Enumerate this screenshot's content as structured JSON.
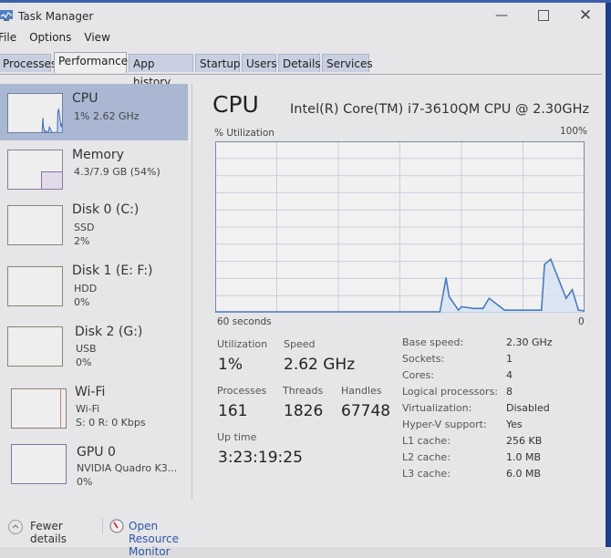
{
  "window": {
    "title": "Task Manager",
    "controls": [
      "minimize",
      "maximize",
      "close"
    ]
  },
  "menu": [
    "File",
    "Options",
    "View"
  ],
  "tabs": [
    {
      "label": "Processes",
      "active": false
    },
    {
      "label": "Performance",
      "active": true
    },
    {
      "label": "App history",
      "active": false
    },
    {
      "label": "Startup",
      "active": false
    },
    {
      "label": "Users",
      "active": false
    },
    {
      "label": "Details",
      "active": false
    },
    {
      "label": "Services",
      "active": false
    }
  ],
  "sidebar": {
    "items": [
      {
        "name": "CPU",
        "line1": "1% 2.62 GHz",
        "line2": "",
        "selected": true,
        "color": "#4a7bbf"
      },
      {
        "name": "Memory",
        "line1": "4.3/7.9 GB (54%)",
        "line2": "",
        "selected": false,
        "color": "#8b6fa8",
        "fill_fraction": 0.54
      },
      {
        "name": "Disk 0 (C:)",
        "line1": "SSD",
        "line2": "2%",
        "selected": false,
        "color": "#6a8a4a"
      },
      {
        "name": "Disk 1 (E: F:)",
        "line1": "HDD",
        "line2": "0%",
        "selected": false,
        "color": "#6a8a4a"
      },
      {
        "name": "Disk 2 (G:)",
        "line1": "USB",
        "line2": "0%",
        "selected": false,
        "color": "#6a8a4a"
      },
      {
        "name": "Wi-Fi",
        "line1": "Wi-Fi",
        "line2": "S: 0 R: 0 Kbps",
        "selected": false,
        "color": "#a0705a"
      },
      {
        "name": "GPU 0",
        "line1": "NVIDIA Quadro K3...",
        "line2": "0%",
        "selected": false,
        "color": "#6a6aa0"
      }
    ]
  },
  "main": {
    "heading": "CPU",
    "model": "Intel(R) Core(TM) i7-3610QM CPU @ 2.30GHz",
    "graph_label": "% Utilization",
    "graph_max": "100%",
    "graph_time": "60 seconds",
    "graph_min": "0",
    "stats": {
      "utilization_label": "Utilization",
      "utilization": "1%",
      "speed_label": "Speed",
      "speed": "2.62 GHz",
      "processes_label": "Processes",
      "processes": "161",
      "threads_label": "Threads",
      "threads": "1826",
      "handles_label": "Handles",
      "handles": "67748",
      "uptime_label": "Up time",
      "uptime": "3:23:19:25"
    },
    "specs": [
      {
        "key": "Base speed:",
        "value": "2.30 GHz"
      },
      {
        "key": "Sockets:",
        "value": "1"
      },
      {
        "key": "Cores:",
        "value": "4"
      },
      {
        "key": "Logical processors:",
        "value": "8"
      },
      {
        "key": "Virtualization:",
        "value": "Disabled"
      },
      {
        "key": "Hyper-V support:",
        "value": "Yes"
      },
      {
        "key": "L1 cache:",
        "value": "256 KB"
      },
      {
        "key": "L2 cache:",
        "value": "1.0 MB"
      },
      {
        "key": "L3 cache:",
        "value": "6.0 MB"
      }
    ]
  },
  "footer": {
    "fewer_details": "Fewer details",
    "open_resource_monitor": "Open Resource Monitor"
  },
  "colors": {
    "cpu_line": "#4a7bbf",
    "cpu_fill": "#d5e3f2",
    "selected_bg": "#a9b7d3",
    "link": "#2e58a8"
  },
  "chart_data": {
    "type": "line",
    "title": "% Utilization",
    "xlabel": "60 seconds",
    "ylabel": "% Utilization",
    "xlim": [
      60,
      0
    ],
    "ylim": [
      0,
      100
    ],
    "grid": true,
    "x": [
      60,
      23.5,
      22.5,
      22,
      20.5,
      20,
      18,
      16.5,
      15.5,
      13,
      7,
      6.5,
      5.5,
      3,
      2,
      1,
      0
    ],
    "series": [
      {
        "name": "CPU",
        "values": [
          0,
          0,
          20,
          9,
          1,
          3,
          2,
          2,
          8,
          1,
          1,
          28,
          31,
          8,
          13,
          1,
          0.5
        ]
      }
    ]
  }
}
